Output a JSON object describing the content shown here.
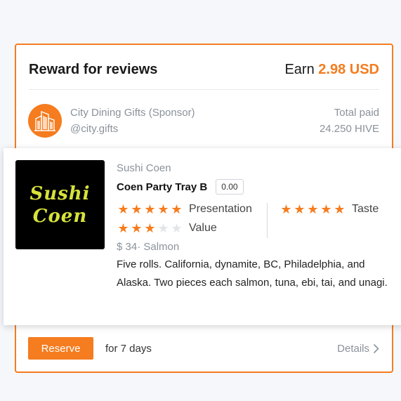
{
  "header": {
    "title": "Reward for reviews",
    "earn_label": "Earn",
    "earn_amount": "2.98 USD"
  },
  "sponsor": {
    "name": "City Dining Gifts (Sponsor)",
    "handle": "@city.gifts",
    "total_label": "Total paid",
    "total_value": "24.250 HIVE",
    "logo_icon": "building-icon"
  },
  "item": {
    "logo_text_1": "Sushi",
    "logo_text_2": "Coen",
    "restaurant": "Sushi Coen",
    "dish": "Coen Party Tray B",
    "price_badge": "0.00",
    "ratings": [
      {
        "label": "Presentation",
        "stars": 5
      },
      {
        "label": "Taste",
        "stars": 5
      },
      {
        "label": "Value",
        "stars": 3
      }
    ],
    "meta": "$ 34· Salmon",
    "description": "Five rolls. California, dynamite, BC, Philadelphia, and Alaska. Two pieces each salmon, tuna, ebi, tai, and unagi."
  },
  "footer": {
    "reserve_label": "Reserve",
    "duration": "for 7 days",
    "details_label": "Details"
  },
  "colors": {
    "accent": "#f57c1f",
    "muted": "#8a929a"
  }
}
